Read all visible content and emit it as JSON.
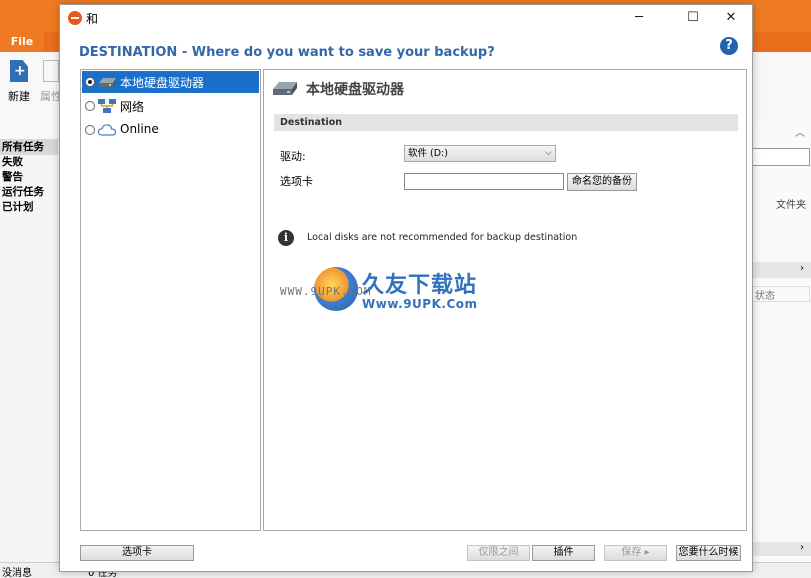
{
  "background_app": {
    "file_tab": "File",
    "ribbon": {
      "new_label": "新建",
      "props_label": "属性"
    },
    "sidebar_items": [
      "所有任务",
      "失败",
      "警告",
      "运行任务",
      "已计划"
    ],
    "right_pane": {
      "label": "文件夹",
      "state_label": "状态"
    },
    "status_bar": {
      "left": "没消息",
      "middle": "0 任务"
    }
  },
  "dialog": {
    "title": "和",
    "window_buttons": {
      "minimize": "─",
      "maximize": "☐",
      "close": "✕"
    },
    "header": "DESTINATION - Where do you want to save your backup?",
    "help": "?",
    "tree": [
      {
        "label": "本地硬盘驱动器",
        "selected": true
      },
      {
        "label": "网络",
        "selected": false
      },
      {
        "label": "Online",
        "selected": false
      }
    ],
    "panel": {
      "heading": "本地硬盘驱动器",
      "section": "Destination",
      "drive_label": "驱动:",
      "drive_value": "软件 (D:)",
      "tab_label": "选项卡",
      "name_input_value": "",
      "name_button": "命名您的备份",
      "info": "Local disks are not recommended for backup destination"
    },
    "watermark": {
      "left": "WWW.9UPK.COM",
      "title": "久友下载站",
      "subtitle": "Www.9UPK.Com"
    },
    "footer": {
      "tabs_button": "选项卡",
      "only_button": "仅限之间",
      "plugin_button": "插件",
      "save_button": "保存 ▸",
      "when_button": "您要什么时候"
    }
  },
  "colors": {
    "accent_orange": "#f07a22",
    "header_blue": "#3467a7",
    "selection_blue": "#1a6fc8"
  }
}
